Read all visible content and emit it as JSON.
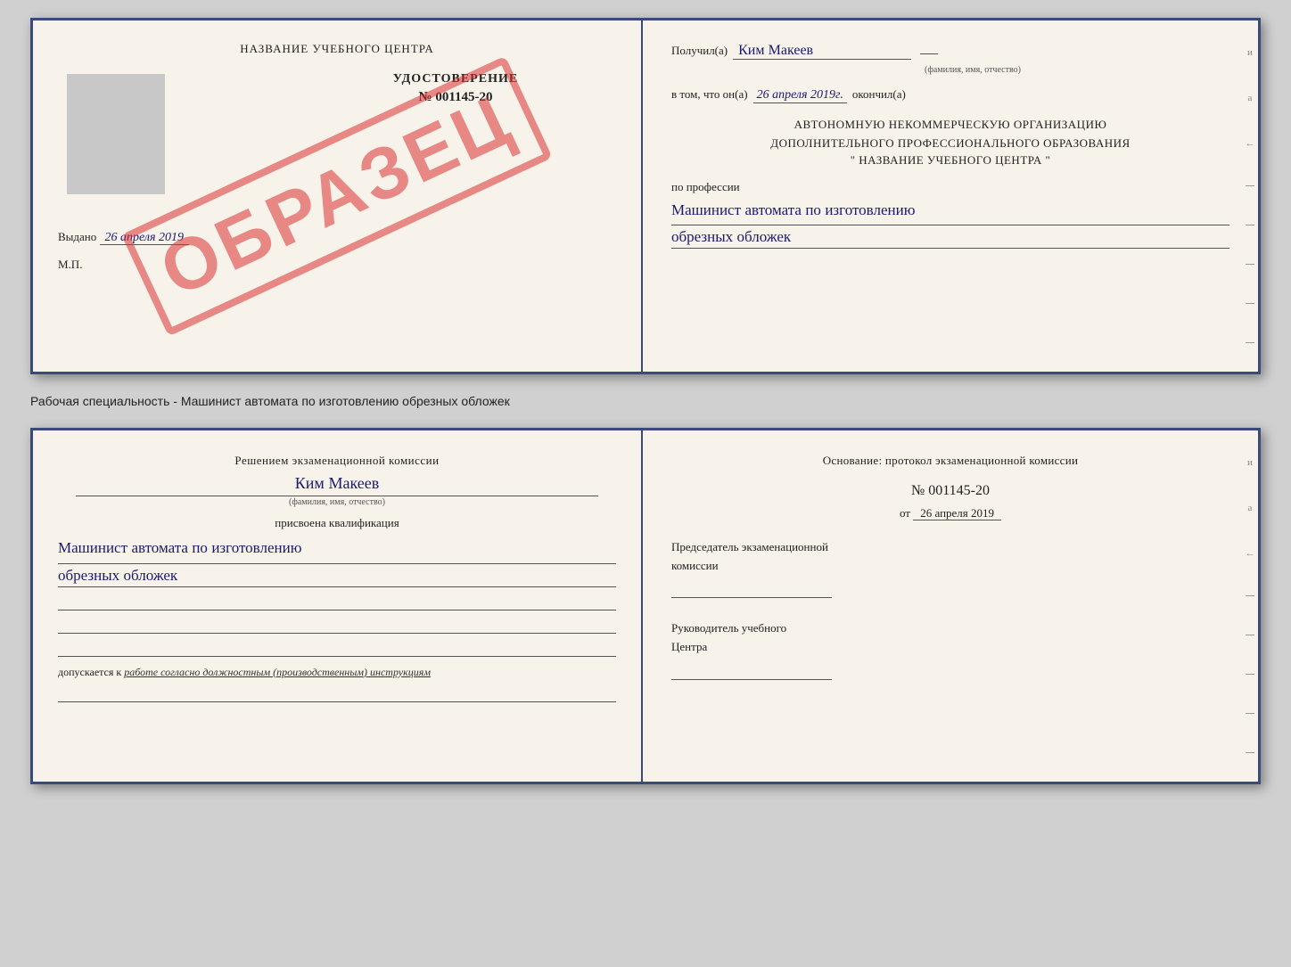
{
  "doc1": {
    "left": {
      "training_center_title": "НАЗВАНИЕ УЧЕБНОГО ЦЕНТРА",
      "cert_title": "УДОСТОВЕРЕНИЕ",
      "cert_number": "№ 001145-20",
      "issued_label": "Выдано",
      "issued_date": "26 апреля 2019",
      "mp_label": "М.П.",
      "stamp_text": "ОБРАЗЕЦ"
    },
    "right": {
      "received_label": "Получил(а)",
      "received_name": "Ким Макеев",
      "fio_subtitle": "(фамилия, имя, отчество)",
      "dash": "–",
      "vtom_label": "в том, что он(а)",
      "date_handwritten": "26 апреля 2019г.",
      "okonchil_label": "окончил(а)",
      "org_line1": "АВТОНОМНУЮ НЕКОММЕРЧЕСКУЮ ОРГАНИЗАЦИЮ",
      "org_line2": "ДОПОЛНИТЕЛЬНОГО ПРОФЕССИОНАЛЬНОГО ОБРАЗОВАНИЯ",
      "org_name": "\"  НАЗВАНИЕ УЧЕБНОГО ЦЕНТРА  \"",
      "i_label": "и",
      "a_label": "а",
      "profession_label": "по профессии",
      "profession_line1": "Машинист автомата по изготовлению",
      "profession_line2": "обрезных обложек"
    }
  },
  "between_label": "Рабочая специальность - Машинист автомата по изготовлению обрезных обложек",
  "doc2": {
    "left": {
      "decision_line1": "Решением  экзаменационной  комиссии",
      "name": "Ким Макеев",
      "fio_label": "(фамилия, имя, отчество)",
      "prisvoyena": "присвоена квалификация",
      "qualification_line1": "Машинист автомата по изготовлению",
      "qualification_line2": "обрезных обложек",
      "dopusk_label": "допускается к",
      "dopusk_text": "работе согласно должностным (производственным) инструкциям"
    },
    "right": {
      "osnovaniye_label": "Основание: протокол экзаменационной  комиссии",
      "protocol_number": "№  001145-20",
      "ot_label": "от",
      "ot_date": "26 апреля 2019",
      "chairman_label": "Председатель экзаменационной",
      "chairman_label2": "комиссии",
      "rukovoditel_label": "Руководитель учебного",
      "rukovoditel_label2": "Центра",
      "i_label": "и",
      "a_label": "а"
    }
  },
  "side_decoration": {
    "dashes": [
      "–",
      "–",
      "–",
      "–",
      "–",
      "–",
      "–",
      "–",
      "–",
      "–"
    ]
  }
}
